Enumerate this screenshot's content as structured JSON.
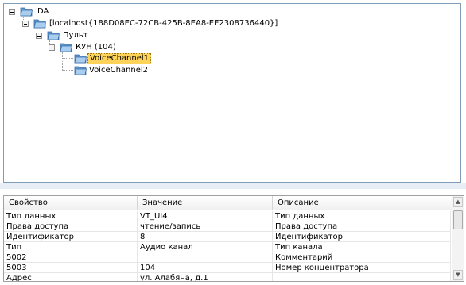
{
  "tree": {
    "root": "DA",
    "host": "[localhost{188D08EC-72CB-425B-8EA8-EE2308736440}]",
    "console": "Пульт",
    "kun": "КУН (104)",
    "channels": [
      "VoiceChannel1",
      "VoiceChannel2"
    ],
    "selected": "VoiceChannel1"
  },
  "grid": {
    "headers": [
      "Свойство",
      "Значение",
      "Описание"
    ],
    "rows": [
      [
        "Тип данных",
        "VT_UI4",
        "Тип данных"
      ],
      [
        "Права доступа",
        "чтение/запись",
        "Права доступа"
      ],
      [
        "Идентификатор",
        "8",
        "Идентификатор"
      ],
      [
        "Тип",
        "Аудио канал",
        "Тип канала"
      ],
      [
        "5002",
        "",
        "Комментарий"
      ],
      [
        "5003",
        "104",
        "Номер концентратора"
      ],
      [
        "Адрес",
        "ул. Алабяна, д.1",
        ""
      ]
    ]
  },
  "icons": {
    "folder": "folder-icon",
    "expand": "collapse-icon",
    "scroll_up": "scroll-up-icon",
    "scroll_down": "scroll-down-icon"
  },
  "colors": {
    "selection": "#fdd35a",
    "folder": "#7aaee0",
    "border": "#7f9db9"
  }
}
